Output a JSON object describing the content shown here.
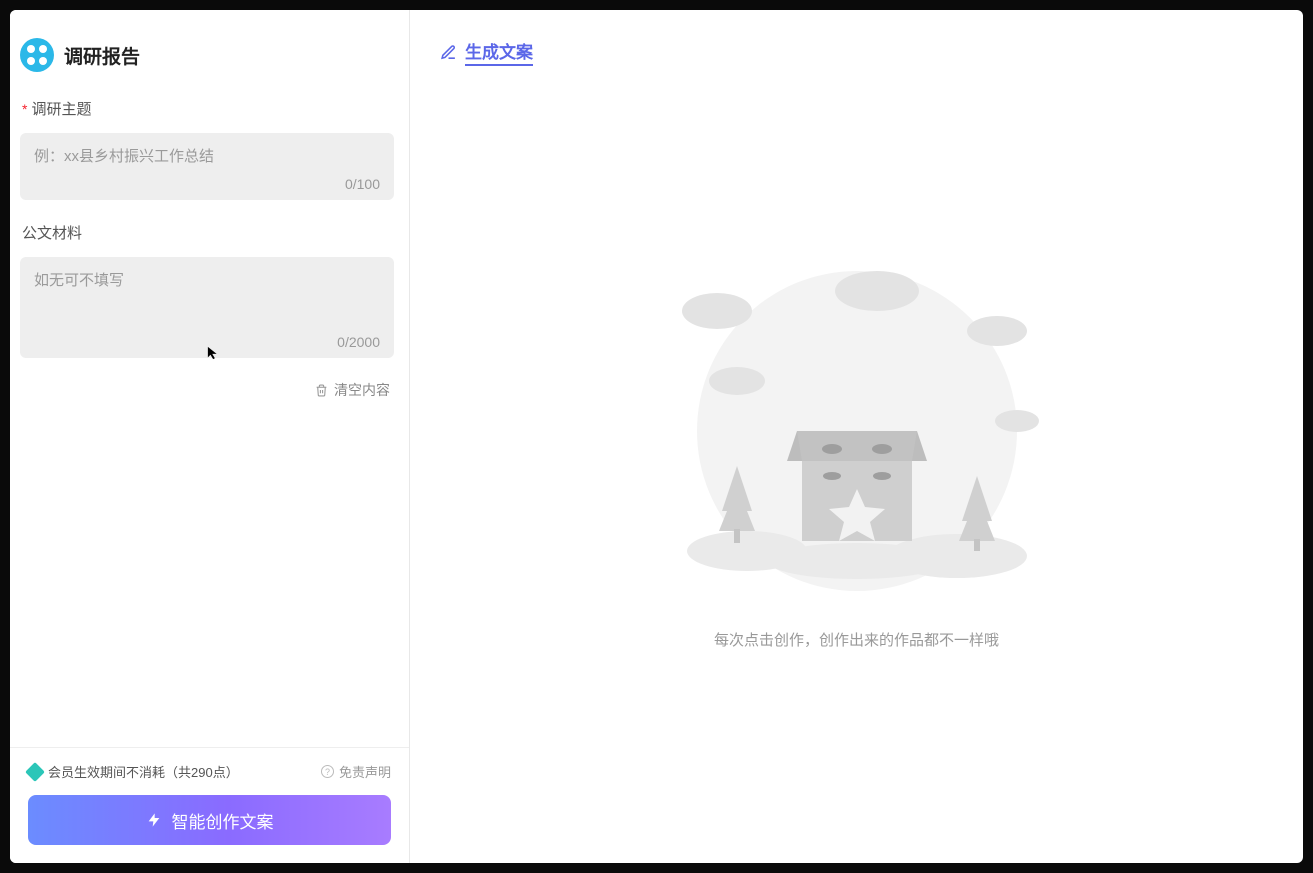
{
  "header": {
    "title": "调研报告"
  },
  "form": {
    "topic": {
      "label": "调研主题",
      "required": true,
      "placeholder": "例：xx县乡村振兴工作总结",
      "value": "",
      "count": "0/100"
    },
    "material": {
      "label": "公文材料",
      "required": false,
      "placeholder": "如无可不填写",
      "value": "",
      "count": "0/2000"
    },
    "clear_label": "清空内容"
  },
  "footer": {
    "credits_text": "会员生效期间不消耗（共290点）",
    "disclaimer_label": "免责声明",
    "generate_label": "智能创作文案"
  },
  "right": {
    "title": "生成文案",
    "empty_hint": "每次点击创作，创作出来的作品都不一样哦"
  }
}
